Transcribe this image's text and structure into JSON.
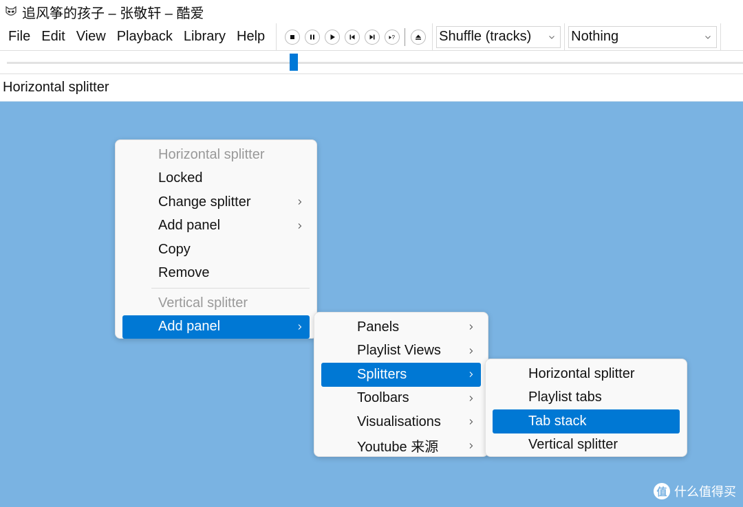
{
  "window": {
    "title": "追风筝的孩子 – 张敬轩 – 酷爱",
    "app_icon": "fox-mask-icon"
  },
  "menubar": {
    "items": [
      "File",
      "Edit",
      "View",
      "Playback",
      "Library",
      "Help"
    ]
  },
  "transport": {
    "buttons": [
      {
        "name": "stop",
        "icon": "stop-icon"
      },
      {
        "name": "pause",
        "icon": "pause-icon"
      },
      {
        "name": "play",
        "icon": "play-icon"
      },
      {
        "name": "previous",
        "icon": "previous-icon"
      },
      {
        "name": "next",
        "icon": "next-icon"
      },
      {
        "name": "random",
        "icon": "random-icon"
      },
      {
        "name": "eject",
        "icon": "eject-icon"
      }
    ]
  },
  "playback_order": {
    "selected": "Shuffle (tracks)"
  },
  "stop_after": {
    "selected": "Nothing"
  },
  "seekbar": {
    "position_fraction": 0.39,
    "accent": "#0078d7"
  },
  "status": {
    "text": "Horizontal splitter"
  },
  "context_menu": {
    "section1_header": "Horizontal splitter",
    "items": [
      {
        "label": "Locked",
        "submenu": false
      },
      {
        "label": "Change splitter",
        "submenu": true
      },
      {
        "label": "Add panel",
        "submenu": true
      },
      {
        "label": "Copy",
        "submenu": false
      },
      {
        "label": "Remove",
        "submenu": false
      }
    ],
    "section2_header": "Vertical splitter",
    "section2_items": [
      {
        "label": "Add panel",
        "submenu": true,
        "active": true
      }
    ]
  },
  "add_panel_menu": {
    "items": [
      {
        "label": "Panels",
        "submenu": true
      },
      {
        "label": "Playlist Views",
        "submenu": true
      },
      {
        "label": "Splitters",
        "submenu": true,
        "active": true
      },
      {
        "label": "Toolbars",
        "submenu": true
      },
      {
        "label": "Visualisations",
        "submenu": true
      },
      {
        "label": "Youtube 来源",
        "submenu": true
      }
    ]
  },
  "splitters_menu": {
    "items": [
      {
        "label": "Horizontal splitter"
      },
      {
        "label": "Playlist tabs"
      },
      {
        "label": "Tab stack",
        "active": true
      },
      {
        "label": "Vertical splitter"
      }
    ]
  },
  "colors": {
    "background": "#7ab3e2",
    "highlight": "#0078d4"
  },
  "watermark": {
    "logo_char": "值",
    "text": "什么值得买"
  }
}
